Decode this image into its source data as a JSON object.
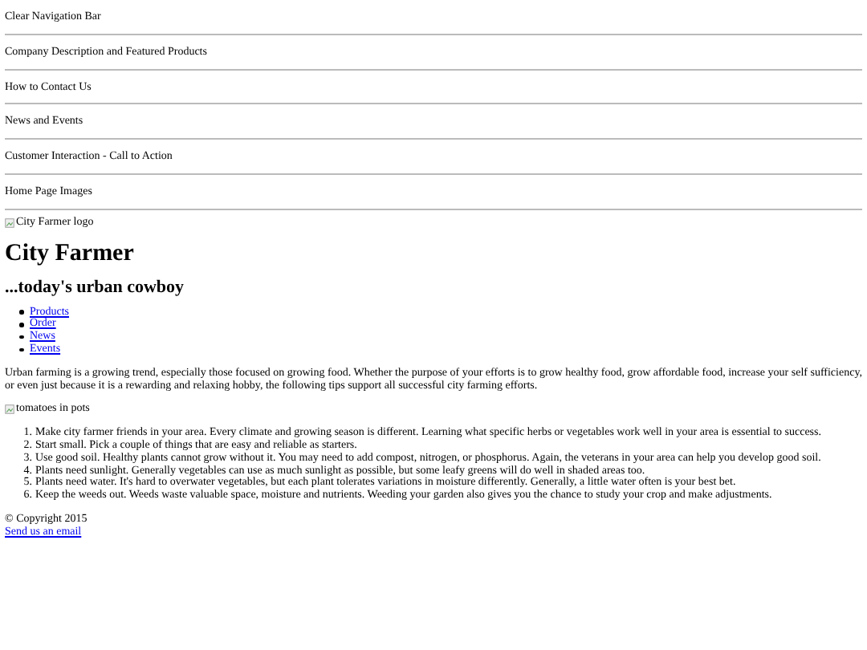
{
  "sections": [
    "Clear Navigation Bar",
    "Company Description and Featured Products",
    "How to Contact Us",
    "News and Events",
    "Customer Interaction - Call to Action",
    "Home Page Images"
  ],
  "logo": {
    "alt": "City Farmer logo"
  },
  "title": "City Farmer",
  "tagline": "...today's urban cowboy",
  "nav_links": [
    "Products",
    "Order",
    "News",
    "Events"
  ],
  "intro": "Urban farming is a growing trend, especially those focused on growing food. Whether the purpose of your efforts is to grow healthy food, grow affordable food, increase your self sufficiency, or even just because it is a rewarding and relaxing hobby, the following tips support all successful city farming efforts.",
  "image": {
    "alt": "tomatoes in pots"
  },
  "tips": [
    {
      "number": "1.",
      "text": "Make city farmer friends in your area. Every climate and growing season is different. Learning what specific herbs or vegetables work well in your area is essential to success."
    },
    {
      "number": "2.",
      "text": "Start small. Pick a couple of things that are easy and reliable as starters."
    },
    {
      "number": "3.",
      "text": "Use good soil. Healthy plants cannot grow without it. You may need to add compost, nitrogen, or phosphorus. Again, the veterans in your area can help you develop good soil."
    },
    {
      "number": "4.",
      "text": "Plants need sunlight. Generally vegetables can use as much sunlight as possible, but some leafy greens will do well in shaded areas too."
    },
    {
      "number": "5.",
      "text": "Plants need water. It's hard to overwater vegetables, but each plant tolerates variations in moisture differently. Generally, a little water often is your best bet."
    },
    {
      "number": "6.",
      "text": "Keep the weeds out. Weeds waste valuable space, moisture and nutrients. Weeding your garden also gives you the chance to study your crop and make adjustments."
    }
  ],
  "copyright": "© Copyright 2015",
  "email_link": "Send us an email"
}
